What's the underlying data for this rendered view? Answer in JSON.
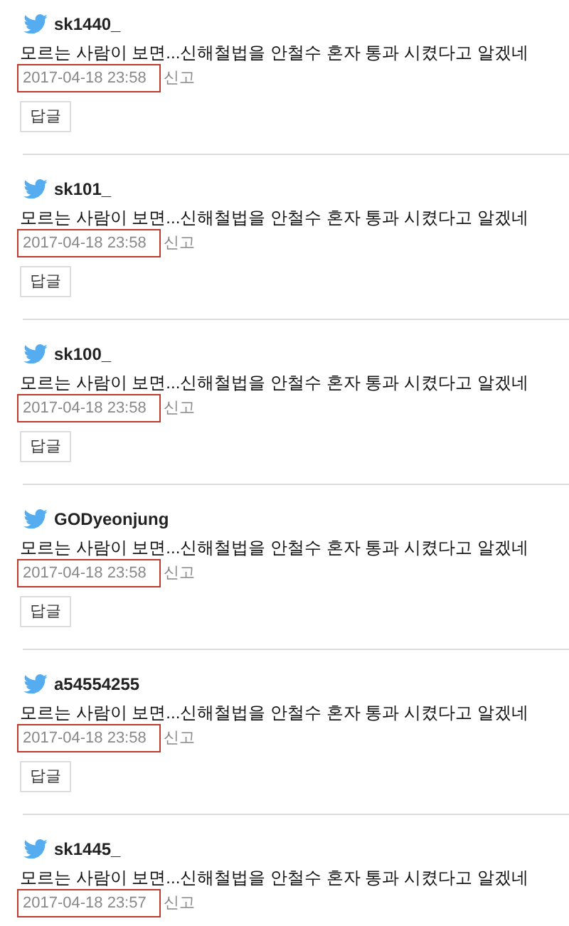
{
  "comments": [
    {
      "username": "sk1440_",
      "text": "모르는 사람이 보면...신해철법을 안철수 혼자 통과 시켰다고 알겠네",
      "date": "2017-04-18 23:58",
      "report": "신고",
      "reply": "답글"
    },
    {
      "username": "sk101_",
      "text": "모르는 사람이 보면...신해철법을 안철수 혼자 통과 시켰다고 알겠네",
      "date": "2017-04-18 23:58",
      "report": "신고",
      "reply": "답글"
    },
    {
      "username": "sk100_",
      "text": "모르는 사람이 보면...신해철법을 안철수 혼자 통과 시켰다고 알겠네",
      "date": "2017-04-18 23:58",
      "report": "신고",
      "reply": "답글"
    },
    {
      "username": "GODyeonjung",
      "text": "모르는 사람이 보면...신해철법을 안철수 혼자 통과 시켰다고 알겠네",
      "date": "2017-04-18 23:58",
      "report": "신고",
      "reply": "답글"
    },
    {
      "username": "a54554255",
      "text": "모르는 사람이 보면...신해철법을 안철수 혼자 통과 시켰다고 알겠네",
      "date": "2017-04-18 23:58",
      "report": "신고",
      "reply": "답글"
    },
    {
      "username": "sk1445_",
      "text": "모르는 사람이 보면...신해철법을 안철수 혼자 통과 시켰다고 알겠네",
      "date": "2017-04-18 23:57",
      "report": "신고"
    }
  ]
}
